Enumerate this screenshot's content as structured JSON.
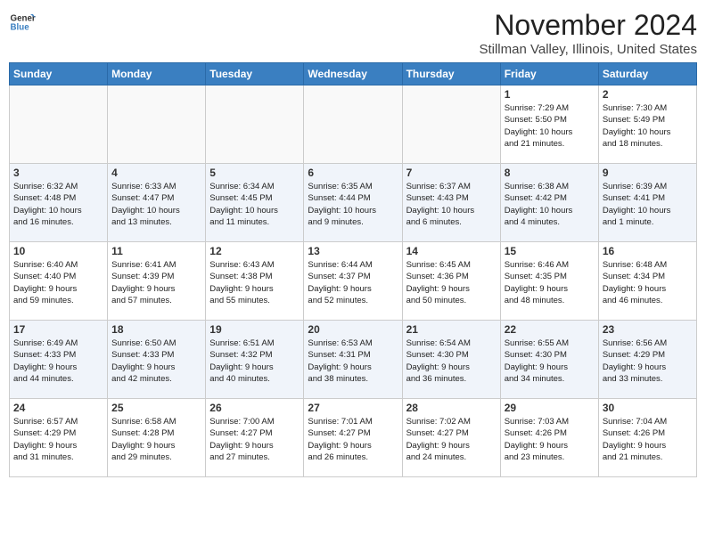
{
  "header": {
    "logo_line1": "General",
    "logo_line2": "Blue",
    "month": "November 2024",
    "location": "Stillman Valley, Illinois, United States"
  },
  "days_of_week": [
    "Sunday",
    "Monday",
    "Tuesday",
    "Wednesday",
    "Thursday",
    "Friday",
    "Saturday"
  ],
  "weeks": [
    {
      "row_alt": false,
      "days": [
        {
          "num": "",
          "info": ""
        },
        {
          "num": "",
          "info": ""
        },
        {
          "num": "",
          "info": ""
        },
        {
          "num": "",
          "info": ""
        },
        {
          "num": "",
          "info": ""
        },
        {
          "num": "1",
          "info": "Sunrise: 7:29 AM\nSunset: 5:50 PM\nDaylight: 10 hours\nand 21 minutes."
        },
        {
          "num": "2",
          "info": "Sunrise: 7:30 AM\nSunset: 5:49 PM\nDaylight: 10 hours\nand 18 minutes."
        }
      ]
    },
    {
      "row_alt": true,
      "days": [
        {
          "num": "3",
          "info": "Sunrise: 6:32 AM\nSunset: 4:48 PM\nDaylight: 10 hours\nand 16 minutes."
        },
        {
          "num": "4",
          "info": "Sunrise: 6:33 AM\nSunset: 4:47 PM\nDaylight: 10 hours\nand 13 minutes."
        },
        {
          "num": "5",
          "info": "Sunrise: 6:34 AM\nSunset: 4:45 PM\nDaylight: 10 hours\nand 11 minutes."
        },
        {
          "num": "6",
          "info": "Sunrise: 6:35 AM\nSunset: 4:44 PM\nDaylight: 10 hours\nand 9 minutes."
        },
        {
          "num": "7",
          "info": "Sunrise: 6:37 AM\nSunset: 4:43 PM\nDaylight: 10 hours\nand 6 minutes."
        },
        {
          "num": "8",
          "info": "Sunrise: 6:38 AM\nSunset: 4:42 PM\nDaylight: 10 hours\nand 4 minutes."
        },
        {
          "num": "9",
          "info": "Sunrise: 6:39 AM\nSunset: 4:41 PM\nDaylight: 10 hours\nand 1 minute."
        }
      ]
    },
    {
      "row_alt": false,
      "days": [
        {
          "num": "10",
          "info": "Sunrise: 6:40 AM\nSunset: 4:40 PM\nDaylight: 9 hours\nand 59 minutes."
        },
        {
          "num": "11",
          "info": "Sunrise: 6:41 AM\nSunset: 4:39 PM\nDaylight: 9 hours\nand 57 minutes."
        },
        {
          "num": "12",
          "info": "Sunrise: 6:43 AM\nSunset: 4:38 PM\nDaylight: 9 hours\nand 55 minutes."
        },
        {
          "num": "13",
          "info": "Sunrise: 6:44 AM\nSunset: 4:37 PM\nDaylight: 9 hours\nand 52 minutes."
        },
        {
          "num": "14",
          "info": "Sunrise: 6:45 AM\nSunset: 4:36 PM\nDaylight: 9 hours\nand 50 minutes."
        },
        {
          "num": "15",
          "info": "Sunrise: 6:46 AM\nSunset: 4:35 PM\nDaylight: 9 hours\nand 48 minutes."
        },
        {
          "num": "16",
          "info": "Sunrise: 6:48 AM\nSunset: 4:34 PM\nDaylight: 9 hours\nand 46 minutes."
        }
      ]
    },
    {
      "row_alt": true,
      "days": [
        {
          "num": "17",
          "info": "Sunrise: 6:49 AM\nSunset: 4:33 PM\nDaylight: 9 hours\nand 44 minutes."
        },
        {
          "num": "18",
          "info": "Sunrise: 6:50 AM\nSunset: 4:33 PM\nDaylight: 9 hours\nand 42 minutes."
        },
        {
          "num": "19",
          "info": "Sunrise: 6:51 AM\nSunset: 4:32 PM\nDaylight: 9 hours\nand 40 minutes."
        },
        {
          "num": "20",
          "info": "Sunrise: 6:53 AM\nSunset: 4:31 PM\nDaylight: 9 hours\nand 38 minutes."
        },
        {
          "num": "21",
          "info": "Sunrise: 6:54 AM\nSunset: 4:30 PM\nDaylight: 9 hours\nand 36 minutes."
        },
        {
          "num": "22",
          "info": "Sunrise: 6:55 AM\nSunset: 4:30 PM\nDaylight: 9 hours\nand 34 minutes."
        },
        {
          "num": "23",
          "info": "Sunrise: 6:56 AM\nSunset: 4:29 PM\nDaylight: 9 hours\nand 33 minutes."
        }
      ]
    },
    {
      "row_alt": false,
      "days": [
        {
          "num": "24",
          "info": "Sunrise: 6:57 AM\nSunset: 4:29 PM\nDaylight: 9 hours\nand 31 minutes."
        },
        {
          "num": "25",
          "info": "Sunrise: 6:58 AM\nSunset: 4:28 PM\nDaylight: 9 hours\nand 29 minutes."
        },
        {
          "num": "26",
          "info": "Sunrise: 7:00 AM\nSunset: 4:27 PM\nDaylight: 9 hours\nand 27 minutes."
        },
        {
          "num": "27",
          "info": "Sunrise: 7:01 AM\nSunset: 4:27 PM\nDaylight: 9 hours\nand 26 minutes."
        },
        {
          "num": "28",
          "info": "Sunrise: 7:02 AM\nSunset: 4:27 PM\nDaylight: 9 hours\nand 24 minutes."
        },
        {
          "num": "29",
          "info": "Sunrise: 7:03 AM\nSunset: 4:26 PM\nDaylight: 9 hours\nand 23 minutes."
        },
        {
          "num": "30",
          "info": "Sunrise: 7:04 AM\nSunset: 4:26 PM\nDaylight: 9 hours\nand 21 minutes."
        }
      ]
    }
  ]
}
